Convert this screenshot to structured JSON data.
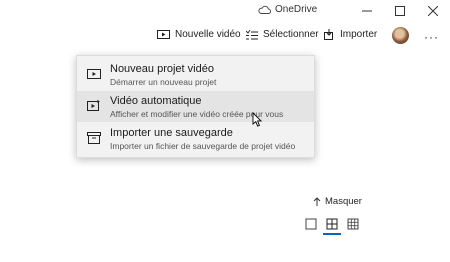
{
  "titlebar": {
    "app_name": "OneDrive"
  },
  "toolbar": {
    "new_video": "Nouvelle vidéo",
    "select": "Sélectionner",
    "import": "Importer",
    "more": "···"
  },
  "menu": {
    "items": [
      {
        "title": "Nouveau projet vidéo",
        "subtitle": "Démarrer un nouveau projet"
      },
      {
        "title": "Vidéo automatique",
        "subtitle": "Afficher et modifier une vidéo créée pour vous"
      },
      {
        "title": "Importer une sauvegarde",
        "subtitle": "Importer un fichier de sauvegarde de projet vidéo"
      }
    ],
    "highlighted_index": 1
  },
  "collection": {
    "hide_label": "Masquer"
  },
  "colors": {
    "accent": "#0067c0",
    "highlight": "#e4e4e4",
    "menu_bg": "#f2f2f2"
  }
}
